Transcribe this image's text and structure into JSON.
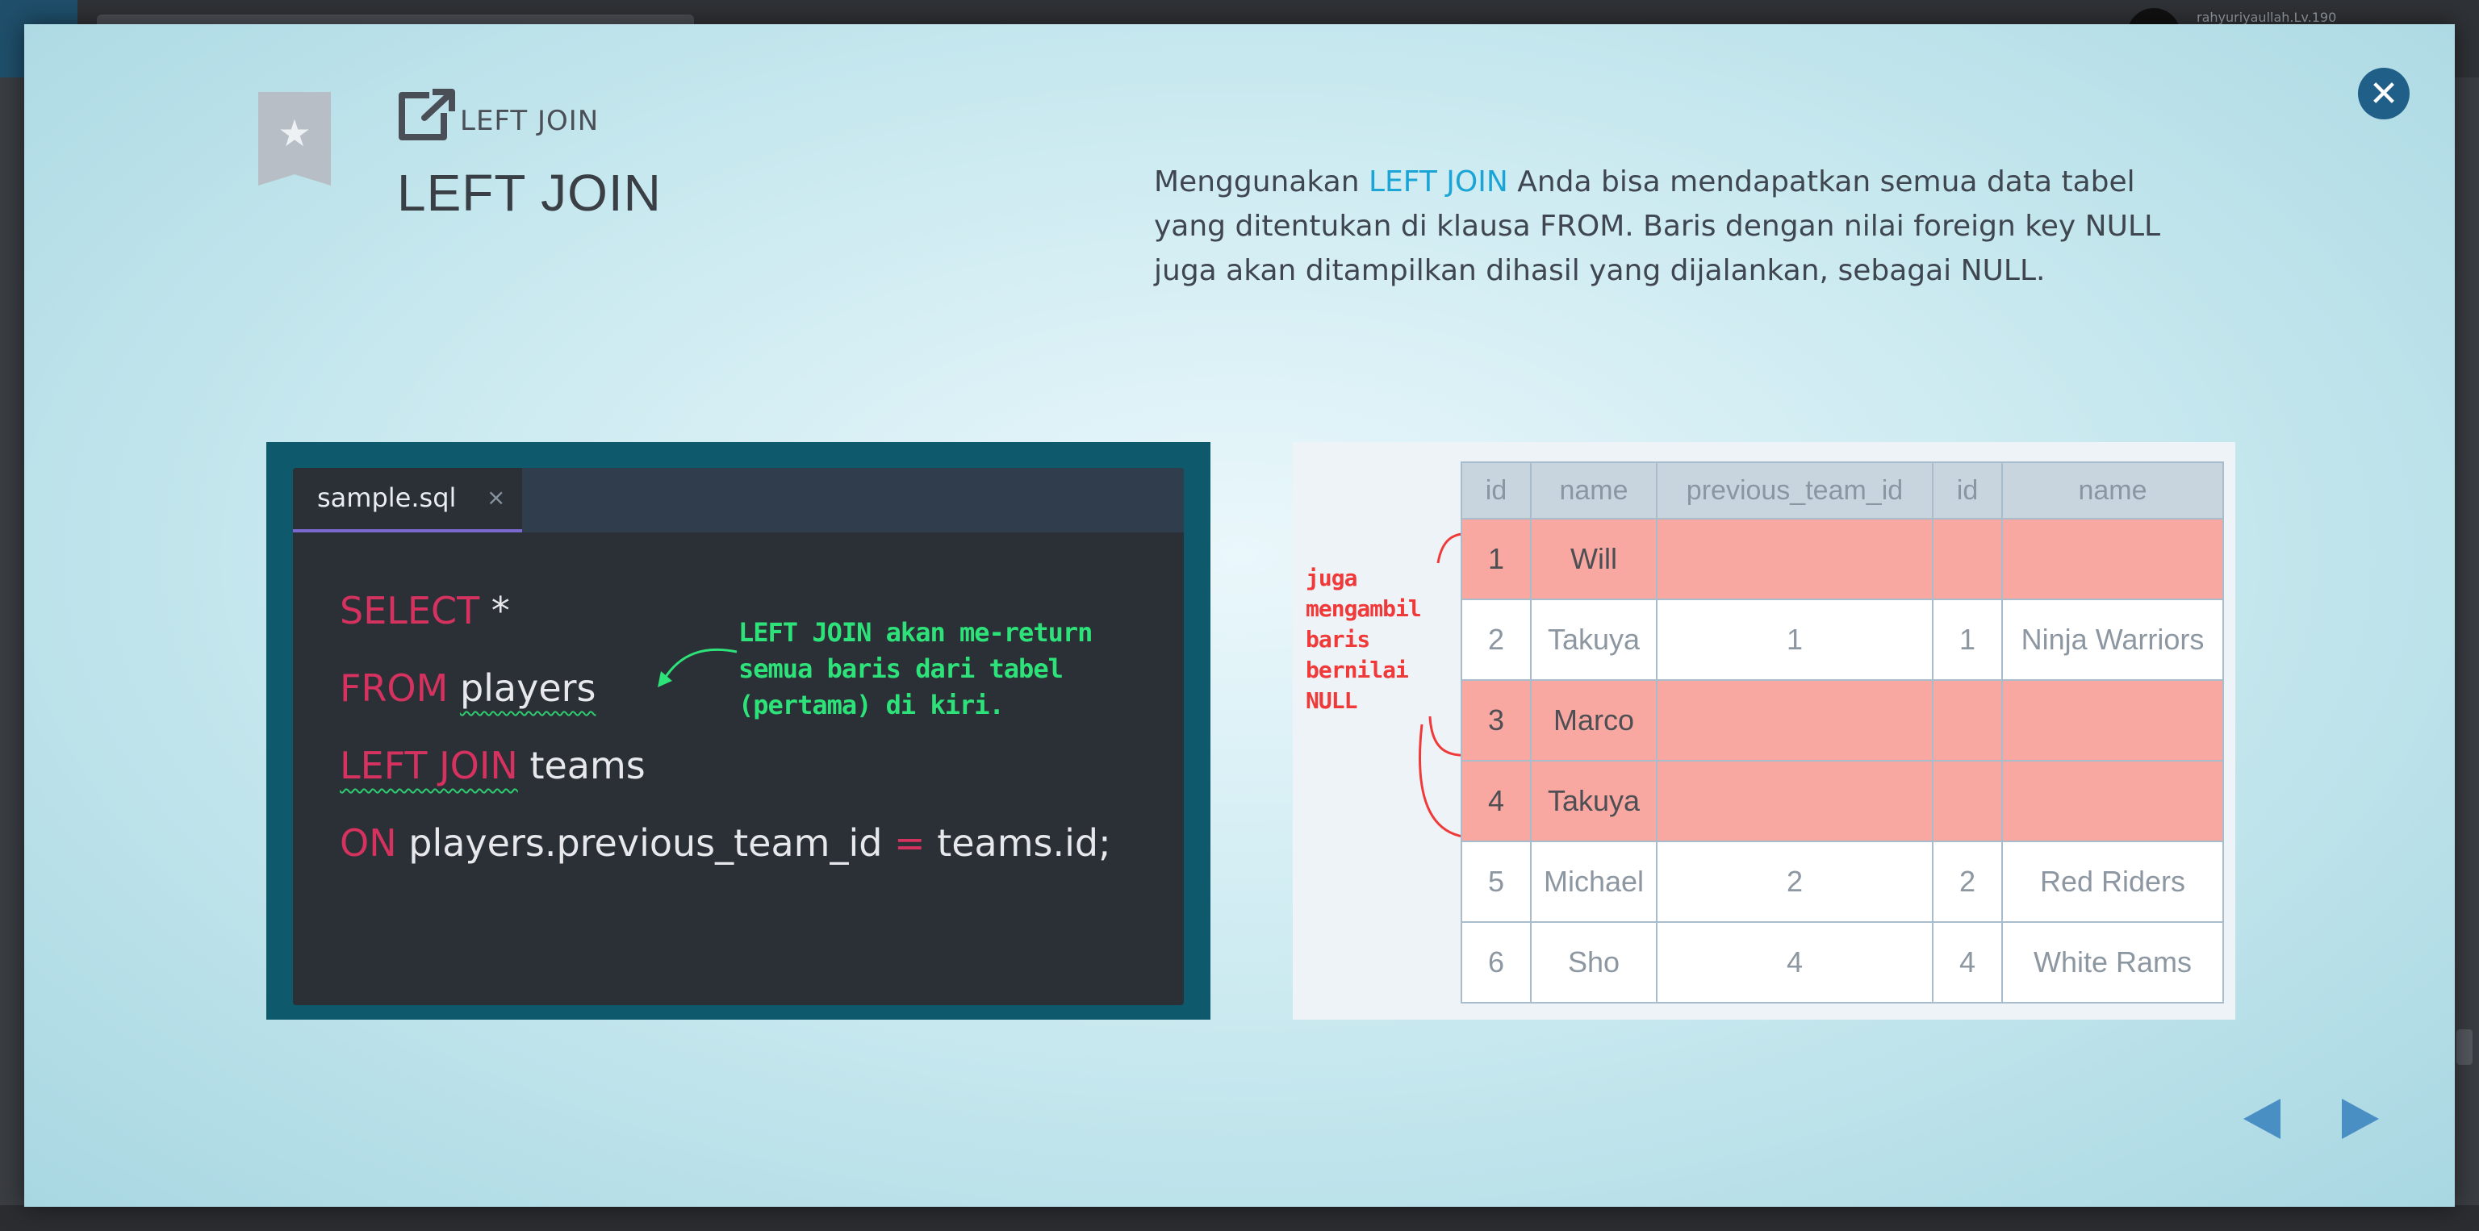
{
  "background": {
    "user_text": "rahyuriyaullah.Lv.190"
  },
  "header": {
    "crumb": "LEFT JOIN",
    "title": "LEFT JOIN",
    "description": {
      "pre": "Menggunakan ",
      "highlight": "LEFT JOIN",
      "post": " Anda bisa mendapatkan semua data tabel yang ditentukan di klausa FROM. Baris dengan nilai foreign key NULL juga akan ditampilkan dihasil yang dijalankan, sebagai NULL."
    }
  },
  "editor": {
    "tab_name": "sample.sql",
    "tab_close": "×",
    "lines": {
      "l1_kw": "SELECT",
      "l1_rest": " *",
      "l2_kw": "FROM",
      "l2_rest": "players",
      "l3_kw": "LEFT JOIN",
      "l3_rest": " teams",
      "l4_kw": "ON",
      "l4_mid": " players.previous_team_id ",
      "l4_eq": "=",
      "l4_rest": " teams.id;"
    },
    "note": "LEFT JOIN akan me-return semua baris dari tabel (pertama) di kiri."
  },
  "result_table": {
    "side_note": "juga mengambil baris bernilai NULL",
    "headers": [
      "id",
      "name",
      "previous_team_id",
      "id",
      "name"
    ],
    "rows": [
      {
        "cells": [
          "1",
          "Will",
          "",
          "",
          ""
        ],
        "null": true
      },
      {
        "cells": [
          "2",
          "Takuya",
          "1",
          "1",
          "Ninja Warriors"
        ],
        "null": false
      },
      {
        "cells": [
          "3",
          "Marco",
          "",
          "",
          ""
        ],
        "null": true
      },
      {
        "cells": [
          "4",
          "Takuya",
          "",
          "",
          ""
        ],
        "null": true
      },
      {
        "cells": [
          "5",
          "Michael",
          "2",
          "2",
          "Red Riders"
        ],
        "null": false
      },
      {
        "cells": [
          "6",
          "Sho",
          "4",
          "4",
          "White Rams"
        ],
        "null": false
      }
    ]
  },
  "colors": {
    "accent": "#1ba5d6",
    "keyword": "#d6325f",
    "note_green": "#2ee27a",
    "null_row": "#f9a8a1",
    "annotation_red": "#f03a3a"
  },
  "icons": {
    "bookmark": "star-bookmark-icon",
    "external": "external-link-icon",
    "close": "close-icon",
    "prev": "triangle-left-icon",
    "next": "triangle-right-icon"
  }
}
